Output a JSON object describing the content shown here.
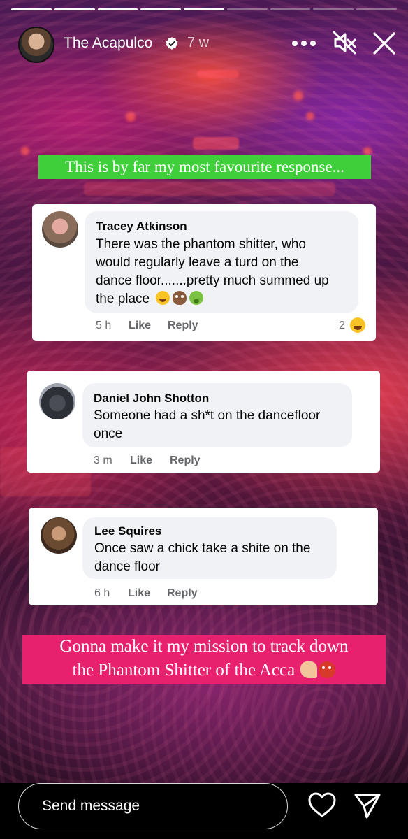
{
  "story": {
    "segments_total": 9,
    "segments_done": 5
  },
  "header": {
    "username": "The Acapulco",
    "time_ago": "7 w",
    "avatar_icon": "profile-avatar",
    "verified_icon": "verified-badge-icon",
    "more_icon": "more-dots-icon",
    "mute_icon": "muted-speaker-icon",
    "close_icon": "close-icon"
  },
  "captions": {
    "top": "This is by far my most favourite response...",
    "bottom_line1": "Gonna make it my mission to track down",
    "bottom_line2": "the Phantom Shitter of the Acca"
  },
  "comments": [
    {
      "name": "Tracey Atkinson",
      "lines": [
        "There was the phantom shitter, who",
        "would regularly leave a turd on the",
        "dance floor.......pretty much summed up",
        "the place"
      ],
      "emojis": [
        "rolling-laughing-icon",
        "poo-icon",
        "nauseated-icon"
      ],
      "time": "5 h",
      "like": "Like",
      "reply": "Reply",
      "reaction_count": "2",
      "reaction_icon": "laughing-reaction-icon"
    },
    {
      "name": "Daniel John Shotton",
      "lines": [
        "Someone had a sh*t on the dancefloor",
        "once"
      ],
      "time": "3 m",
      "like": "Like",
      "reply": "Reply"
    },
    {
      "name": "Lee Squires",
      "lines": [
        "Once saw a chick take a shite on the",
        "dance floor"
      ],
      "time": "6 h",
      "like": "Like",
      "reply": "Reply"
    }
  ],
  "footer": {
    "message_placeholder": "Send message",
    "heart_icon": "heart-icon",
    "share_icon": "send-icon"
  },
  "colors": {
    "green_caption": "#3fcf3a",
    "pink_caption": "#e8216f",
    "card_bg": "#ffffff",
    "bubble_bg": "#f0f2f5"
  }
}
